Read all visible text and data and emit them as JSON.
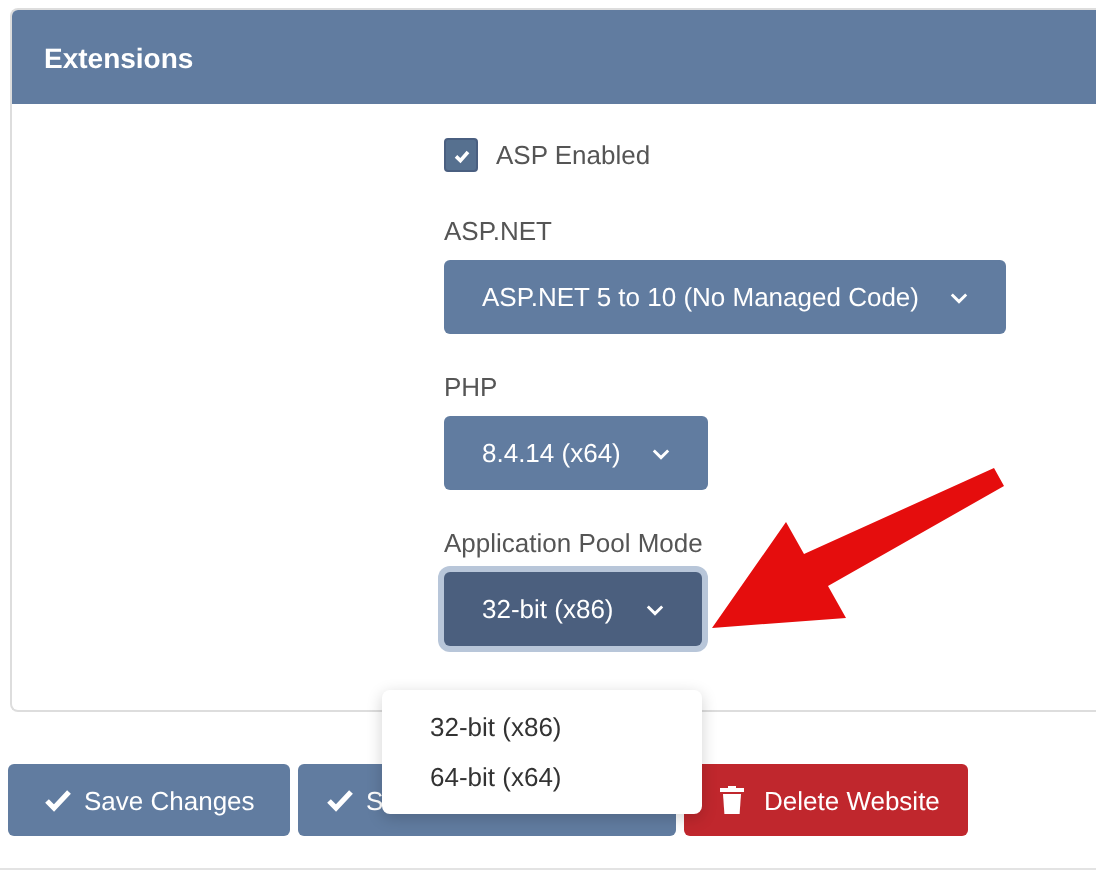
{
  "panel": {
    "title": "Extensions"
  },
  "asp": {
    "label": "ASP Enabled",
    "checked": true
  },
  "selects": [
    {
      "label": "ASP.NET",
      "value": "ASP.NET 5 to 10 (No Managed Code)",
      "focused": false
    },
    {
      "label": "PHP",
      "value": "8.4.14 (x64)",
      "focused": false
    },
    {
      "label": "Application Pool Mode",
      "value": "32-bit (x86)",
      "focused": true
    }
  ],
  "dropdown_menu": [
    {
      "label": "32-bit (x86)"
    },
    {
      "label": "64-bit (x64)"
    }
  ],
  "buttons": [
    {
      "label": "Save Changes",
      "kind": "save"
    },
    {
      "label": "S",
      "kind": "save"
    },
    {
      "label": "Delete Website",
      "kind": "delete"
    }
  ]
}
